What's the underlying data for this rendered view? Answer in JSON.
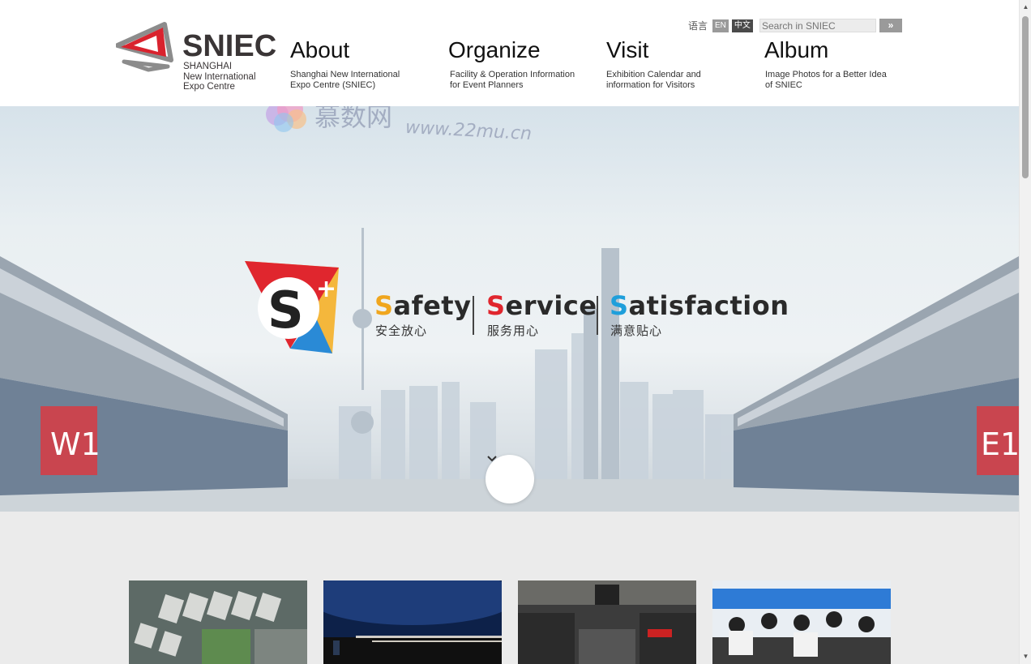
{
  "brand": {
    "name": "SNIEC",
    "sub_line1": "SHANGHAI",
    "sub_line2": "New International",
    "sub_line3": "Expo Centre",
    "red": "#d9232e",
    "gray": "#8c8c8c"
  },
  "nav": [
    {
      "title": "About",
      "desc_line1": "Shanghai New International",
      "desc_line2": "Expo Centre (SNIEC)"
    },
    {
      "title": "Organize",
      "desc_line1": "Facility & Operation Information",
      "desc_line2": "for Event Planners"
    },
    {
      "title": "Visit",
      "desc_line1": "Exhibition Calendar and",
      "desc_line2": "information for Visitors"
    },
    {
      "title": "Album",
      "desc_line1": "Image Photos for a Better Idea",
      "desc_line2": "of SNIEC"
    }
  ],
  "language": {
    "label": "语言",
    "en": "EN",
    "cn": "中文"
  },
  "search": {
    "placeholder": "Search in SNIEC",
    "button_icon": "double-chevron-right-icon",
    "button_glyph": "»"
  },
  "watermark": {
    "cn": "慕数网",
    "url": "www.22mu.cn"
  },
  "hero": {
    "slogan": [
      {
        "initial": "S",
        "rest": "afety",
        "cn": "安全放心",
        "color": "#f0a61e"
      },
      {
        "initial": "S",
        "rest": "ervice",
        "cn": "服务用心",
        "color": "#e0262e"
      },
      {
        "initial": "S",
        "rest": "atisfaction",
        "cn": "满意贴心",
        "color": "#1f9fdb"
      }
    ],
    "hall_left": "W1",
    "hall_right": "E1",
    "scroll_icon": "chevron-down-icon",
    "scroll_glyph": "⌄"
  },
  "cards": [
    {
      "name": "aerial-view-photo"
    },
    {
      "name": "conference-photo"
    },
    {
      "name": "exhibition-hall-photo"
    },
    {
      "name": "vr-visitors-photo"
    }
  ]
}
